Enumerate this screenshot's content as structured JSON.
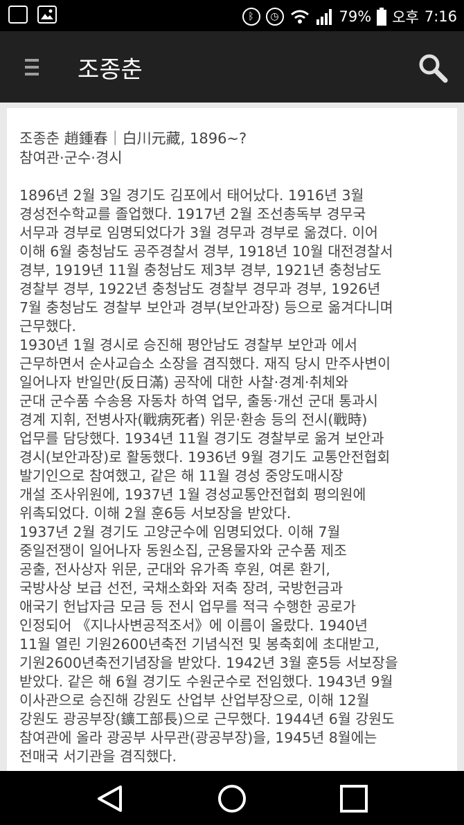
{
  "status_bar": {
    "battery": "79%",
    "ampm": "오후",
    "time": "7:16"
  },
  "app_bar": {
    "title": "조종춘"
  },
  "article": {
    "header": "조종춘 趙鍾春｜白川元藏, 1896~?",
    "subheader": "참여관·군수·경시",
    "p1": [
      "1896년 2월 3일 경기도 김포에서 태어났다. 1916년 3월",
      "경성전수학교를 졸업했다. 1917년 2월 조선총독부 경무국",
      "서무과 경부로 임명되었다가 3월 경무과 경부로 옮겼다. 이어",
      "이해 6월 충청남도 공주경찰서 경부, 1918년 10월 대전경찰서",
      "경부, 1919년 11월 충청남도 제3부 경부, 1921년 충청남도",
      "경찰부 경부, 1922년 충청남도 경찰부 경무과 경부, 1926년",
      "7월 충청남도 경찰부 보안과 경부(보안과장) 등으로 옮겨다니며",
      "근무했다."
    ],
    "p2": [
      "1930년 1월 경시로 승진해 평안남도 경찰부 보안과 에서",
      "근무하면서 순사교습소 소장을 겸직했다. 재직 당시 만주사변이",
      "일어나자 반일만(反日滿) 공작에 대한 사찰·경계·취체와",
      "군대 군수품 수송용 자동차 하역 업무, 출동·개선 군대 통과시",
      "경계 지휘, 전병사자(戰病死者) 위문·환송 등의 전시(戰時)",
      "업무를 담당했다. 1934년 11월 경기도 경찰부로 옮겨 보안과",
      "경시(보안과장)로 활동했다. 1936년 9월 경기도 교통안전협회",
      "발기인으로 참여했고, 같은 해 11월 경성 중앙도매시장",
      "개설 조사위원에, 1937년 1월 경성교통안전협회 평의원에",
      "위촉되었다. 이해 2월 훈6등 서보장을 받았다."
    ],
    "p3": [
      "1937년 2월 경기도 고양군수에 임명되었다. 이해 7월",
      "중일전쟁이 일어나자 동원소집, 군용물자와 군수품 제조",
      "공출, 전사상자 위문, 군대와 유가족 후원, 여론 환기,",
      "국방사상 보급 선전, 국채소화와 저축 장려, 국방헌금과",
      "애국기 헌납자금 모금 등 전시 업무를 적극 수행한 공로가",
      "인정되어 《지나사변공적조서》에 이름이 올랐다. 1940년",
      "11월 열린 기원2600년축전 기념식전 및 봉축회에 초대받고,",
      "기원2600년축전기념장을 받았다. 1942년 3월 훈5등 서보장을",
      "받았다. 같은 해 6월 경기도 수원군수로 전임했다. 1943년 9월",
      "이사관으로 승진해 강원도 산업부 산업부장으로, 이해 12월",
      "강원도 광공부장(鑛工部長)으로 근무했다. 1944년 6월 강원도",
      "참여관에 올라 광공부 사무관(광공부장)을, 1945년 8월에는",
      "전매국 서기관을 겸직했다."
    ]
  }
}
